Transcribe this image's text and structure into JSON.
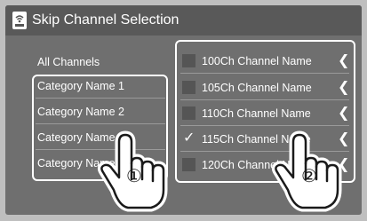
{
  "header": {
    "title": "Skip Channel Selection",
    "icon": "satellite-radio-icon"
  },
  "all_channels_label": "All Channels",
  "categories": [
    {
      "label": "Category Name 1"
    },
    {
      "label": "Category Name 2"
    },
    {
      "label": "Category Name 3"
    },
    {
      "label": "Category Name 4"
    }
  ],
  "channels": [
    {
      "label": "100Ch Channel Name",
      "checked": false
    },
    {
      "label": "105Ch Channel Name",
      "checked": false
    },
    {
      "label": "110Ch Channel Name",
      "checked": false
    },
    {
      "label": "115Ch Channel Name",
      "checked": true
    },
    {
      "label": "120Ch Channel Name",
      "checked": false
    }
  ],
  "check_mark": "✓",
  "arrow_glyph": "❮",
  "callouts": {
    "one": "①",
    "two": "②"
  },
  "colors": {
    "screen_bg": "#6f6f6f",
    "title_bg": "#595959",
    "frame_bg": "#bfbfbf",
    "highlight": "#ffffff"
  }
}
